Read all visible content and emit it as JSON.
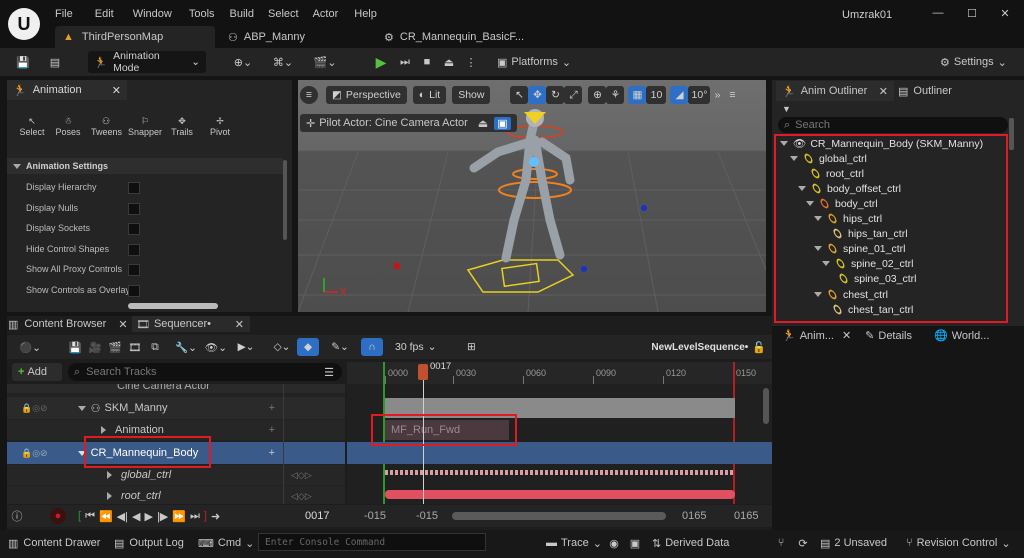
{
  "titlebar": {
    "menus": [
      "File",
      "Edit",
      "Window",
      "Tools",
      "Build",
      "Select",
      "Actor",
      "Help"
    ],
    "user": "Umzrak01"
  },
  "tabs": [
    {
      "label": "ThirdPersonMap"
    },
    {
      "label": "ABP_Manny"
    },
    {
      "label": "CR_Mannequin_BasicF..."
    }
  ],
  "toolbar": {
    "mode": "Animation Mode",
    "platforms": "Platforms",
    "settings": "Settings"
  },
  "animation": {
    "title": "Animation",
    "tools": [
      "Select",
      "Poses",
      "Tweens",
      "Snapper",
      "Trails",
      "Pivot"
    ],
    "section": "Animation Settings",
    "options": [
      "Display Hierarchy",
      "Display Nulls",
      "Display Sockets",
      "Hide Control Shapes",
      "Show All Proxy Controls",
      "Show Controls as Overlay"
    ]
  },
  "viewport": {
    "perspective": "Perspective",
    "lit": "Lit",
    "show": "Show",
    "grid": "10",
    "angle": "10°",
    "pilot": "Pilot Actor: Cine Camera Actor"
  },
  "outliner": {
    "tab": "Anim Outliner",
    "tab2": "Outliner",
    "search": "Search",
    "root": "CR_Mannequin_Body  (SKM_Manny)",
    "items": [
      "global_ctrl",
      "root_ctrl",
      "body_offset_ctrl",
      "body_ctrl",
      "hips_ctrl",
      "hips_tan_ctrl",
      "spine_01_ctrl",
      "spine_02_ctrl",
      "spine_03_ctrl",
      "chest_ctrl",
      "chest_tan_ctrl"
    ],
    "bottom_tabs": [
      "Anim...",
      "Details",
      "World..."
    ]
  },
  "sequencer": {
    "tab1": "Content Browser",
    "tab2": "Sequencer•",
    "fps": "30 fps",
    "name": "NewLevelSequence•",
    "add": "Add",
    "search": "Search Tracks",
    "tracks": [
      "Cine Camera Actor",
      "SKM_Manny",
      "Animation",
      "CR_Mannequin_Body",
      "global_ctrl",
      "root_ctrl"
    ],
    "clip": "MF_Run_Fwd",
    "playhead": "0017",
    "ticks": [
      "0000",
      "0030",
      "0060",
      "0090",
      "0120",
      "0150"
    ],
    "frame": "0017",
    "range_start1": "-015",
    "range_start2": "-015",
    "range_end1": "0165",
    "range_end2": "0165"
  },
  "statusbar": {
    "drawer": "Content Drawer",
    "log": "Output Log",
    "cmd": "Cmd",
    "console": "Enter Console Command",
    "trace": "Trace",
    "derived": "Derived Data",
    "unsaved": "2 Unsaved",
    "revision": "Revision Control"
  }
}
